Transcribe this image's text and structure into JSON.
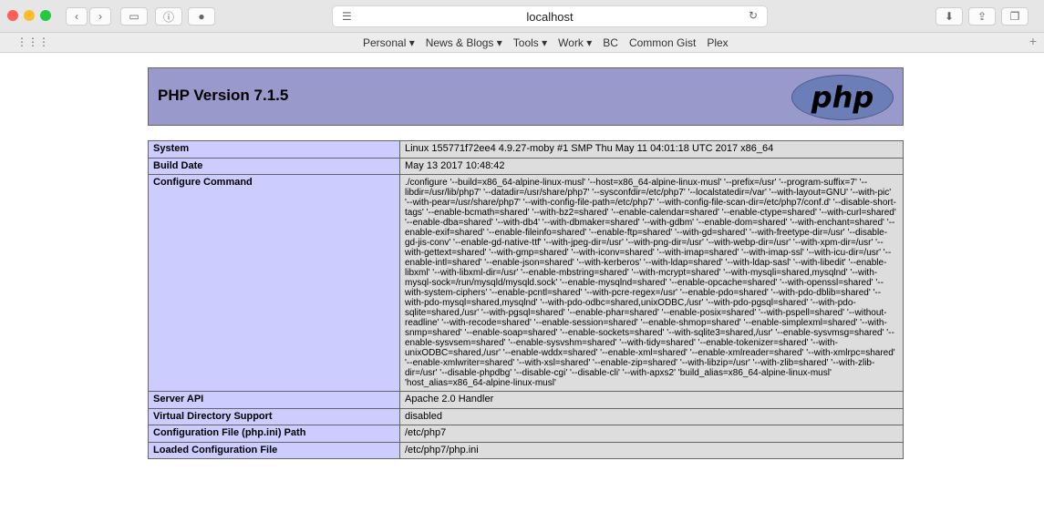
{
  "browser": {
    "url": "localhost",
    "bookmarks": [
      "Personal ▾",
      "News & Blogs ▾",
      "Tools ▾",
      "Work ▾",
      "BC",
      "Common Gist",
      "Plex"
    ]
  },
  "php": {
    "version_title": "PHP Version 7.1.5",
    "logo_text": "php"
  },
  "table": [
    {
      "label": "System",
      "value": "Linux 155771f72ee4 4.9.27-moby #1 SMP Thu May 11 04:01:18 UTC 2017 x86_64"
    },
    {
      "label": "Build Date",
      "value": "May 13 2017 10:48:42"
    },
    {
      "label": "Configure Command",
      "value": "./configure '--build=x86_64-alpine-linux-musl' '--host=x86_64-alpine-linux-musl' '--prefix=/usr' '--program-suffix=7' '--libdir=/usr/lib/php7' '--datadir=/usr/share/php7' '--sysconfdir=/etc/php7' '--localstatedir=/var' '--with-layout=GNU' '--with-pic' '--with-pear=/usr/share/php7' '--with-config-file-path=/etc/php7' '--with-config-file-scan-dir=/etc/php7/conf.d' '--disable-short-tags' '--enable-bcmath=shared' '--with-bz2=shared' '--enable-calendar=shared' '--enable-ctype=shared' '--with-curl=shared' '--enable-dba=shared' '--with-db4' '--with-dbmaker=shared' '--with-gdbm' '--enable-dom=shared' '--with-enchant=shared' '--enable-exif=shared' '--enable-fileinfo=shared' '--enable-ftp=shared' '--with-gd=shared' '--with-freetype-dir=/usr' '--disable-gd-jis-conv' '--enable-gd-native-ttf' '--with-jpeg-dir=/usr' '--with-png-dir=/usr' '--with-webp-dir=/usr' '--with-xpm-dir=/usr' '--with-gettext=shared' '--with-gmp=shared' '--with-iconv=shared' '--with-imap=shared' '--with-imap-ssl' '--with-icu-dir=/usr' '--enable-intl=shared' '--enable-json=shared' '--with-kerberos' '--with-ldap=shared' '--with-ldap-sasl' '--with-libedit' '--enable-libxml' '--with-libxml-dir=/usr' '--enable-mbstring=shared' '--with-mcrypt=shared' '--with-mysqli=shared,mysqlnd' '--with-mysql-sock=/run/mysqld/mysqld.sock' '--enable-mysqlnd=shared' '--enable-opcache=shared' '--with-openssl=shared' '--with-system-ciphers' '--enable-pcntl=shared' '--with-pcre-regex=/usr' '--enable-pdo=shared' '--with-pdo-dblib=shared' '--with-pdo-mysql=shared,mysqlnd' '--with-pdo-odbc=shared,unixODBC,/usr' '--with-pdo-pgsql=shared' '--with-pdo-sqlite=shared,/usr' '--with-pgsql=shared' '--enable-phar=shared' '--enable-posix=shared' '--with-pspell=shared' '--without-readline' '--with-recode=shared' '--enable-session=shared' '--enable-shmop=shared' '--enable-simplexml=shared' '--with-snmp=shared' '--enable-soap=shared' '--enable-sockets=shared' '--with-sqlite3=shared,/usr' '--enable-sysvmsg=shared' '--enable-sysvsem=shared' '--enable-sysvshm=shared' '--with-tidy=shared' '--enable-tokenizer=shared' '--with-unixODBC=shared,/usr' '--enable-wddx=shared' '--enable-xml=shared' '--enable-xmlreader=shared' '--with-xmlrpc=shared' '--enable-xmlwriter=shared' '--with-xsl=shared' '--enable-zip=shared' '--with-libzip=/usr' '--with-zlib=shared' '--with-zlib-dir=/usr' '--disable-phpdbg' '--disable-cgi' '--disable-cli' '--with-apxs2' 'build_alias=x86_64-alpine-linux-musl' 'host_alias=x86_64-alpine-linux-musl'"
    },
    {
      "label": "Server API",
      "value": "Apache 2.0 Handler"
    },
    {
      "label": "Virtual Directory Support",
      "value": "disabled"
    },
    {
      "label": "Configuration File (php.ini) Path",
      "value": "/etc/php7"
    },
    {
      "label": "Loaded Configuration File",
      "value": "/etc/php7/php.ini"
    }
  ],
  "colors": {
    "header_bg": "#9999cc",
    "label_bg": "#ccccff",
    "value_bg": "#dddddd"
  }
}
